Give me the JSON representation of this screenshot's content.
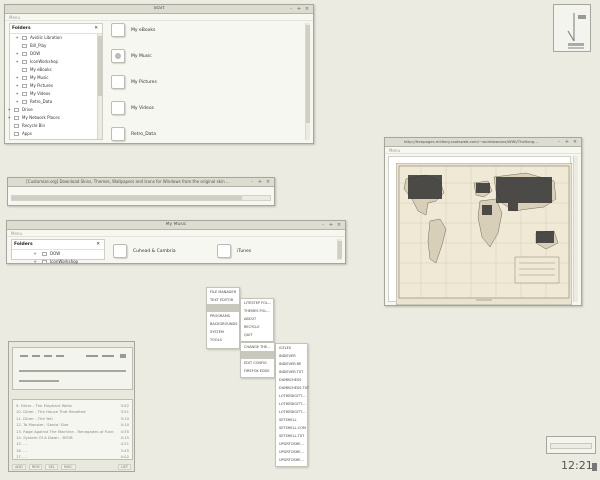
{
  "explorer": {
    "title": "Start",
    "menu": "Menu",
    "folders_label": "Folders",
    "close_glyph": "✕",
    "tree": [
      {
        "label": "Avidiic Libration",
        "exp": "+",
        "indent": 1
      },
      {
        "label": "Bill_Play",
        "exp": "",
        "indent": 1
      },
      {
        "label": "DOW",
        "exp": "+",
        "indent": 1
      },
      {
        "label": "IconWorkshop",
        "exp": "+",
        "indent": 1
      },
      {
        "label": "My eBooks",
        "exp": "",
        "indent": 1
      },
      {
        "label": "My Music",
        "exp": "+",
        "indent": 1
      },
      {
        "label": "My Pictures",
        "exp": "+",
        "indent": 1
      },
      {
        "label": "My Videos",
        "exp": "+",
        "indent": 1
      },
      {
        "label": "Retro_Data",
        "exp": "+",
        "indent": 1
      },
      {
        "label": "Drive",
        "exp": "+",
        "indent": 0
      },
      {
        "label": "My Network Places",
        "exp": "+",
        "indent": 0
      },
      {
        "label": "Recycle Bin",
        "exp": "",
        "indent": 0
      },
      {
        "label": "Apps",
        "exp": "",
        "indent": 0
      }
    ],
    "items": [
      "My eBooks",
      "My Music",
      "My Pictures",
      "My Videos",
      "Retro_Data"
    ]
  },
  "web_bar": {
    "title": "[Customize.org] Download Skins, Themes, Wallpapers and Icons for Windows from the original skin ..."
  },
  "music_win": {
    "title": "My Music",
    "menu": "Menu",
    "folders_label": "Folders",
    "close_glyph": "✕",
    "tree": [
      {
        "label": "DOW",
        "exp": "+"
      },
      {
        "label": "IconWorkshop",
        "exp": "+"
      }
    ],
    "items": [
      "Cuhead & Cambria",
      "iTunes"
    ]
  },
  "browser": {
    "title": "http://freepages.military.rootsweb.com/~worldwarone/WWI/TheSong...",
    "menu": "Menu"
  },
  "start_menu": {
    "col1": [
      "FILE MANAGER",
      "TEXT EDITOR",
      "",
      "PROGRAMS",
      "BACKGROUNDS",
      "SYSTEM",
      "TOOLS"
    ],
    "col2": [
      "LITESTEP FOL...",
      "THEMES FOL...",
      "ABOUT",
      "RECYCLE",
      "QUIT"
    ],
    "col3": [
      "CHANGE THE...",
      "",
      "EDIT CONFIG",
      "FIREFOX EDGE"
    ],
    "col4": [
      "ICELES",
      "INDIEVER",
      "INDIEVER.RE",
      "INDIEVER.TXT",
      "DUMBCHESS",
      "DUMBCHESS.TXT",
      "LOTHEDIGITT...",
      "LOTHEDIGITT...",
      "LOTHEDIGITT...",
      "SETSHELL",
      "SETSHELL.COM",
      "SETSHELL.TXT",
      "UPGRTOSHE...",
      "UPGRTOSHE...",
      "UPGRTOSHE..."
    ]
  },
  "player": {
    "playlist": [
      {
        "t": "9. Dürer - The Elephant Waltz",
        "d": "3:52"
      },
      {
        "t": "10. Dürer - The House That Revolted",
        "d": "3:51"
      },
      {
        "t": "11. Dürer - The Yeti",
        "d": "3:10"
      },
      {
        "t": "12. To Monster, 'Santa' Size",
        "d": "4:10"
      },
      {
        "t": "13. Rage Against The Machine - Renegades of Funk",
        "d": "4:35"
      },
      {
        "t": "14. System Of A Down - BYOB",
        "d": "4:15"
      },
      {
        "t": "15. ...",
        "d": "4:21"
      },
      {
        "t": "16. ...",
        "d": "3:45"
      },
      {
        "t": "17. ...",
        "d": "4:02"
      }
    ],
    "buttons": [
      "ADD",
      "REM",
      "SEL",
      "MISC",
      "LIST"
    ]
  },
  "clock": {
    "time": "12:21"
  },
  "colors": {
    "desktop": "#ebebe1",
    "frame": "#a6a69a",
    "titlebar": "#dddcd0"
  }
}
